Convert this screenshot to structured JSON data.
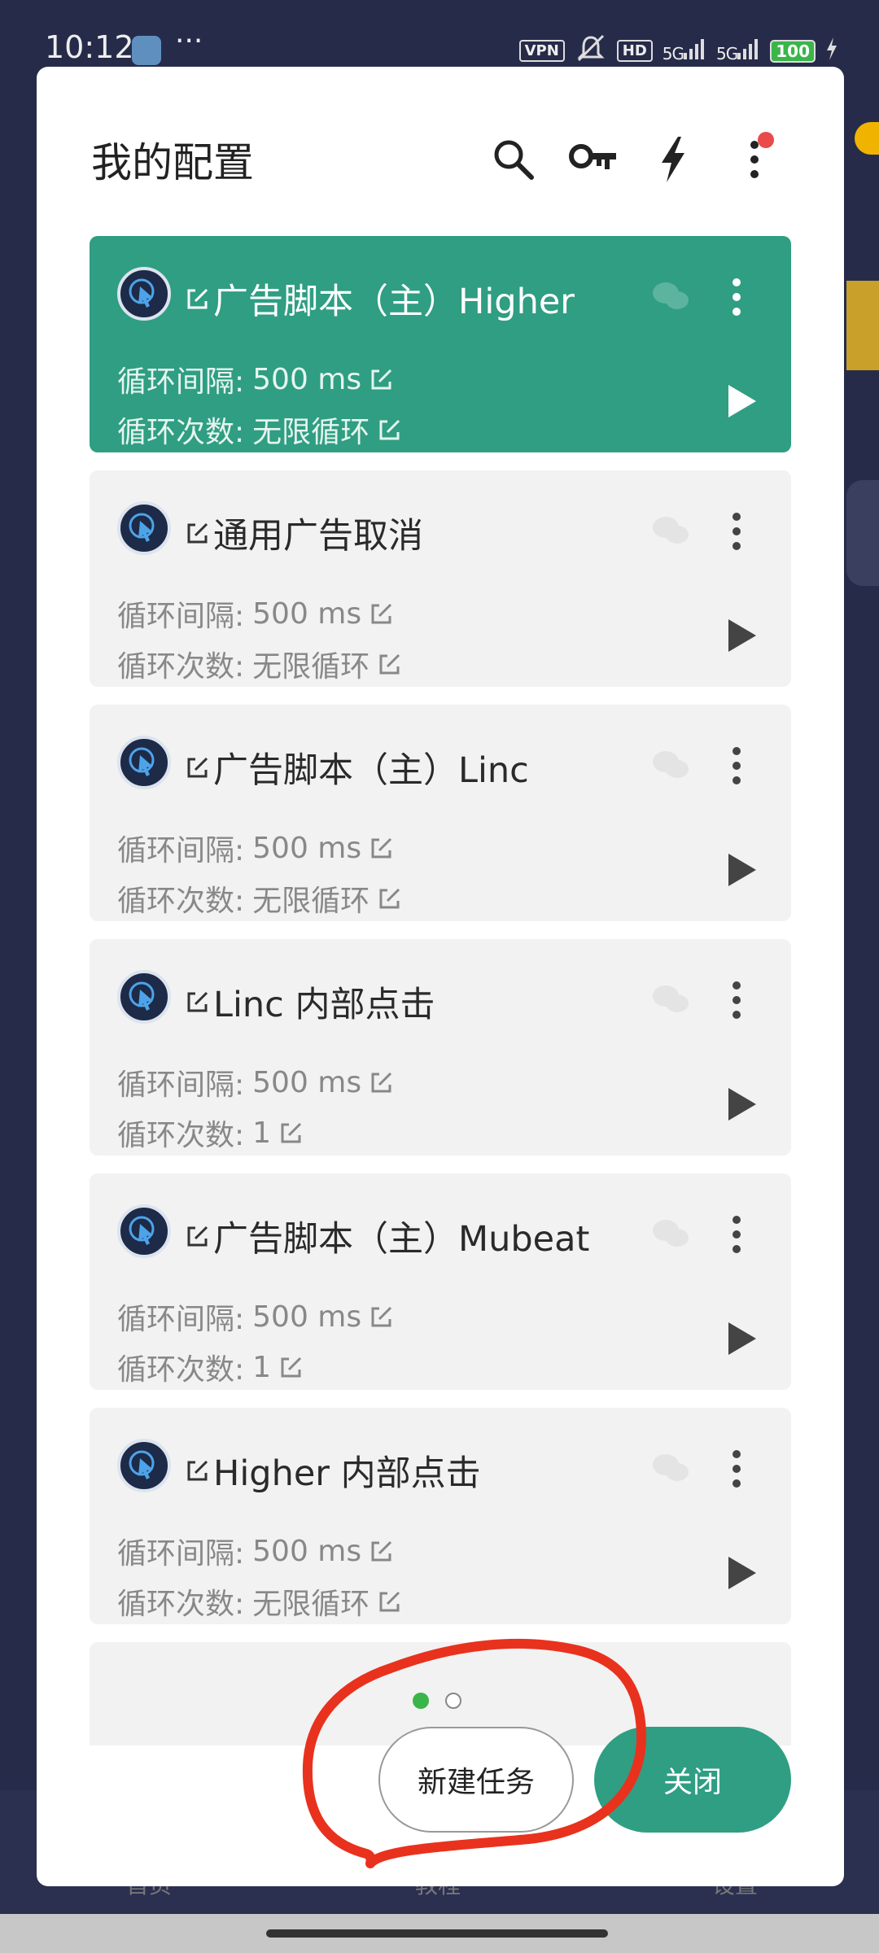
{
  "status_bar": {
    "time": "10:12",
    "more": "···",
    "vpn": "VPN",
    "hd": "HD",
    "net1": "5G",
    "net2": "5G",
    "battery": "100"
  },
  "dialog": {
    "title": "我的配置"
  },
  "cards": [
    {
      "title": "广告脚本（主）Higher",
      "interval_label": "循环间隔:",
      "interval_value": "500 ms",
      "count_label": "循环次数:",
      "count_value": "无限循环",
      "active": true
    },
    {
      "title": "通用广告取消",
      "interval_label": "循环间隔:",
      "interval_value": "500 ms",
      "count_label": "循环次数:",
      "count_value": "无限循环",
      "active": false
    },
    {
      "title": "广告脚本（主）Linc",
      "interval_label": "循环间隔:",
      "interval_value": "500 ms",
      "count_label": "循环次数:",
      "count_value": "无限循环",
      "active": false
    },
    {
      "title": "Linc 内部点击",
      "interval_label": "循环间隔:",
      "interval_value": "500 ms",
      "count_label": "循环次数:",
      "count_value": "1",
      "active": false
    },
    {
      "title": "广告脚本（主）Mubeat",
      "interval_label": "循环间隔:",
      "interval_value": "500 ms",
      "count_label": "循环次数:",
      "count_value": "1",
      "active": false
    },
    {
      "title": "Higher 内部点击",
      "interval_label": "循环间隔:",
      "interval_value": "500 ms",
      "count_label": "循环次数:",
      "count_value": "无限循环",
      "active": false
    }
  ],
  "buttons": {
    "new_task": "新建任务",
    "close": "关闭"
  },
  "background_nav": {
    "home": "首页",
    "tutorial": "教程",
    "settings": "设置"
  },
  "colors": {
    "accent": "#2f9e83",
    "annotation_red": "#e8321e"
  },
  "pager": {
    "current": 1,
    "total": 2
  }
}
